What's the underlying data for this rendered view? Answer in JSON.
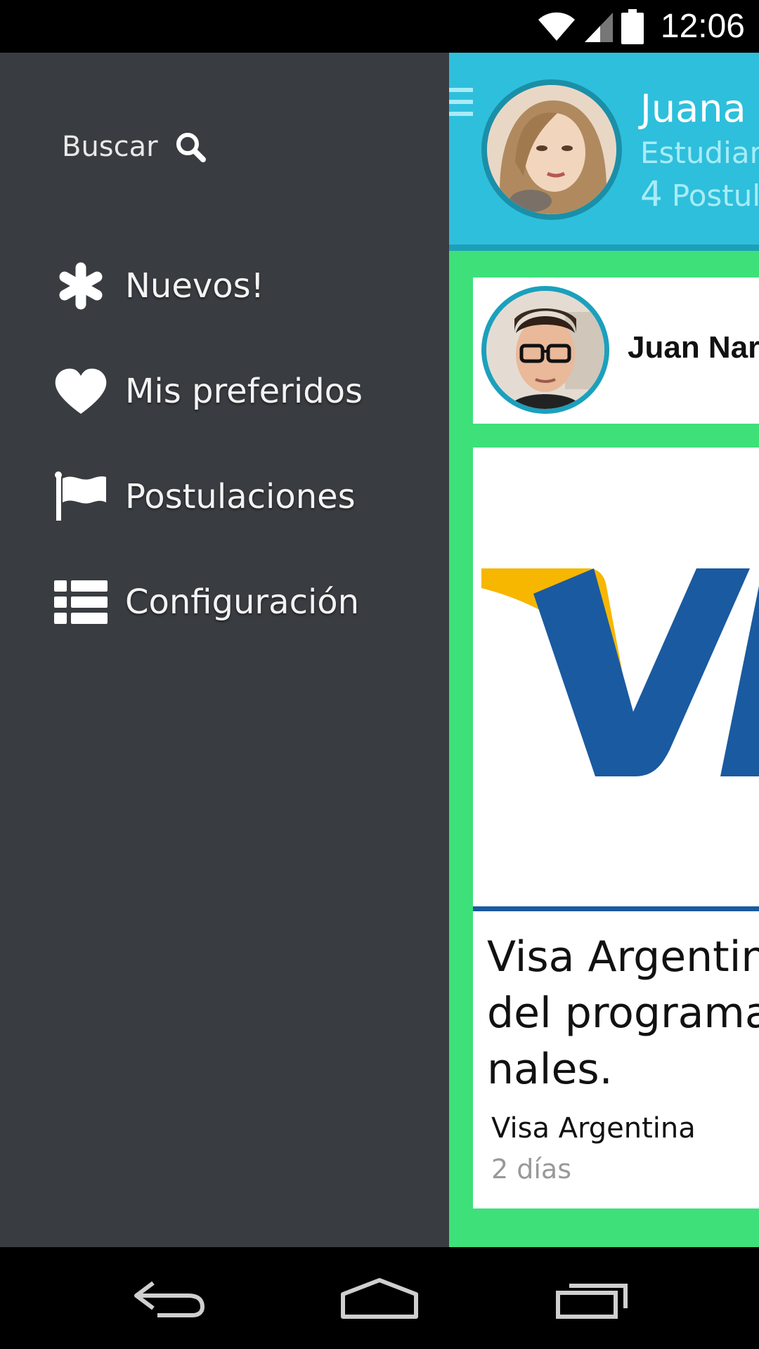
{
  "status_bar": {
    "time": "12:06",
    "icons": [
      "wifi-icon",
      "cell-signal-icon",
      "battery-icon"
    ]
  },
  "drawer": {
    "search_label": "Buscar",
    "items": [
      {
        "label": "Nuevos!",
        "icon": "asterisk-icon"
      },
      {
        "label": "Mis preferidos",
        "icon": "heart-icon"
      },
      {
        "label": "Postulaciones",
        "icon": "flag-icon"
      },
      {
        "label": "Configuración",
        "icon": "list-icon"
      }
    ]
  },
  "profile": {
    "name": "Juana C",
    "role": "Estudiant",
    "count": "4",
    "count_label": "Postula"
  },
  "user_card": {
    "name": "Juan Nar"
  },
  "post_card": {
    "title": "Visa Argentina\ndel programa\nnales.",
    "company": "Visa Argentina",
    "time": "2 días"
  },
  "colors": {
    "drawer_bg": "#393c40",
    "header_bg": "#2ebfdc",
    "content_bg": "#3ee07a",
    "visa_blue": "#1a5aa0",
    "visa_gold": "#f7b600"
  }
}
